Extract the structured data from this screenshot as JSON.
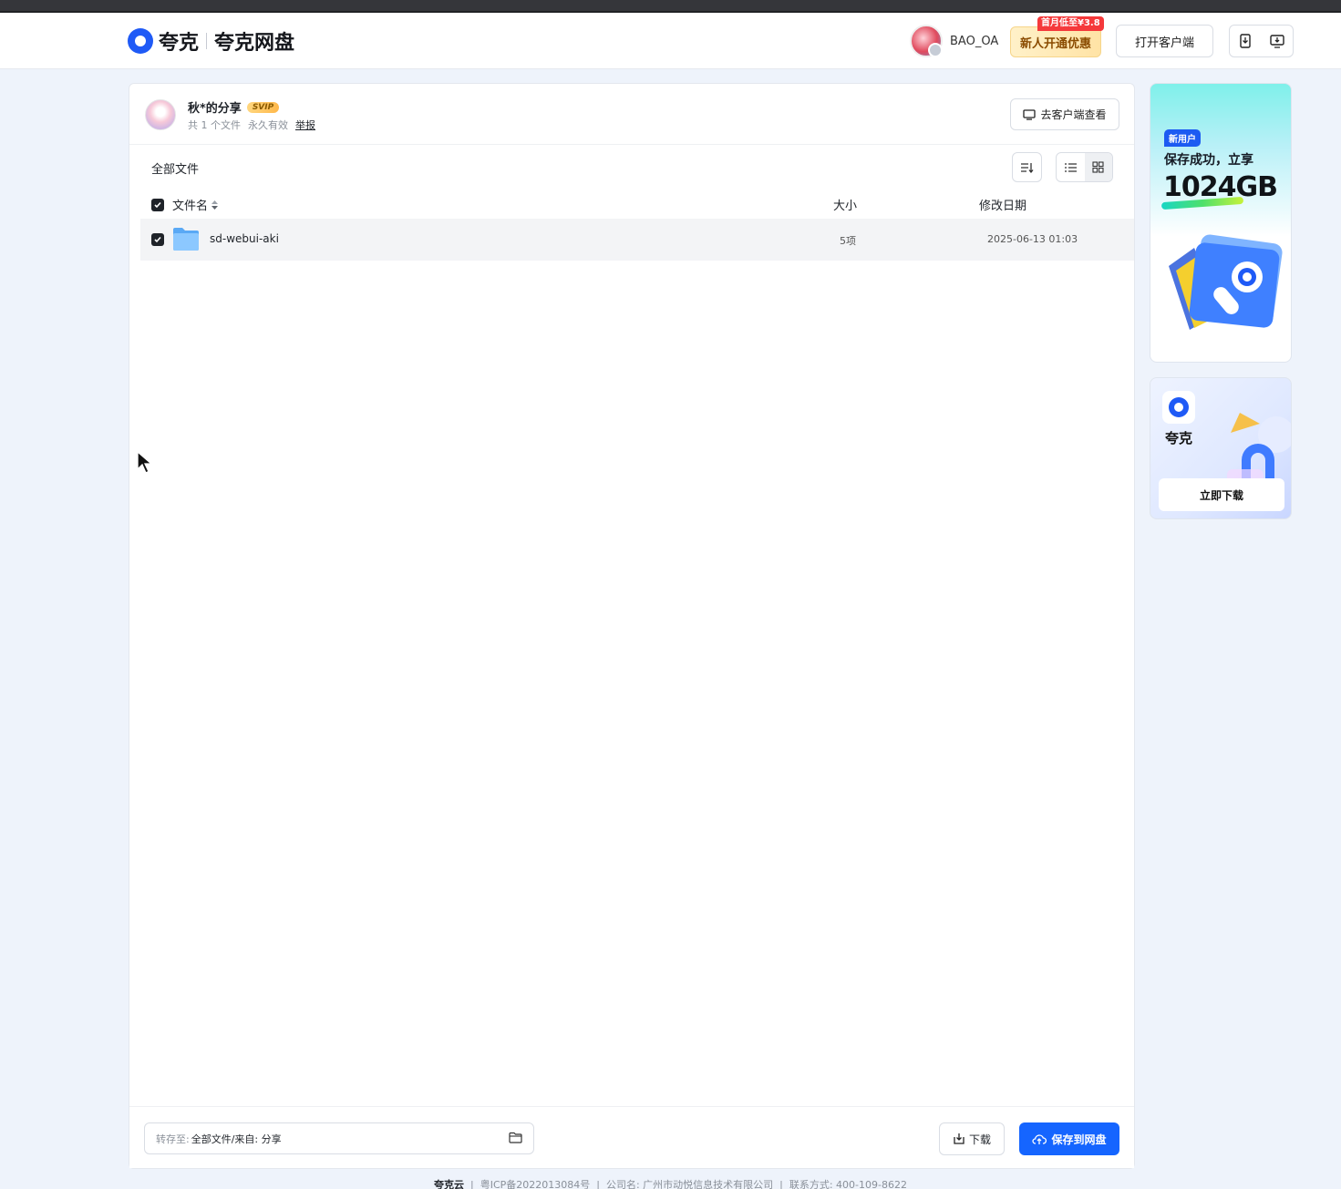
{
  "header": {
    "logo_text": "夸克",
    "logo_sub": "夸克网盘",
    "username": "BAO_OA",
    "promo_button": "新人开通优惠",
    "promo_badge": "首月低至¥3.8",
    "open_client": "打开客户端"
  },
  "share": {
    "sharer_name": "秋*的分享",
    "vip_badge": "SVIP",
    "file_count": "共 1 个文件",
    "validity": "永久有效",
    "report": "举报",
    "to_client": "去客户端查看"
  },
  "file_list": {
    "breadcrumb": "全部文件",
    "columns": {
      "name": "文件名",
      "size": "大小",
      "date": "修改日期"
    },
    "rows": [
      {
        "name": "sd-webui-aki",
        "size": "5项",
        "date": "2025-06-13 01:03",
        "checked": true
      }
    ],
    "select_all_checked": true
  },
  "bottom": {
    "save_to_label": "转存至:",
    "save_to_value": "全部文件/来自: 分享",
    "download": "下载",
    "save": "保存到网盘"
  },
  "ads": {
    "ad1_tag": "新用户",
    "ad1_line1": "保存成功，立享",
    "ad1_big": "1024GB",
    "ad2_name": "夸克",
    "ad2_button": "立即下载"
  },
  "footer": {
    "brand": "夸克云",
    "icp": "粤ICP备2022013084号",
    "company": "公司名: 广州市动悦信息技术有限公司",
    "contact": "联系方式: 400-109-8622"
  },
  "colors": {
    "primary": "#1565ff",
    "page_bg": "#eef3fb",
    "promo_badge": "#f5393b"
  }
}
